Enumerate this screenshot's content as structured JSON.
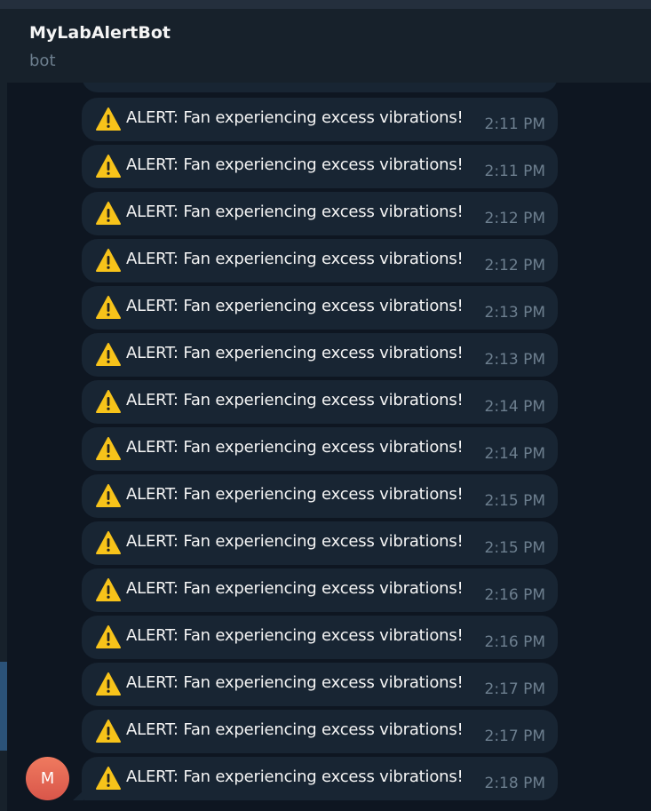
{
  "header": {
    "title": "MyLabAlertBot",
    "subtitle": "bot"
  },
  "avatar": {
    "initial": "M",
    "color": "#e2664f"
  },
  "colors": {
    "chat_bg": "#0e1621",
    "bubble": "#182533",
    "header": "#17212b",
    "time": "#6d7f8f",
    "selected": "#2b5278"
  },
  "messages": [
    {
      "icon": "warning-icon",
      "text": "ALERT: Fan experiencing excess vibrations!",
      "time": "2:11 PM"
    },
    {
      "icon": "warning-icon",
      "text": "ALERT: Fan experiencing excess vibrations!",
      "time": "2:11 PM"
    },
    {
      "icon": "warning-icon",
      "text": "ALERT: Fan experiencing excess vibrations!",
      "time": "2:12 PM"
    },
    {
      "icon": "warning-icon",
      "text": "ALERT: Fan experiencing excess vibrations!",
      "time": "2:12 PM"
    },
    {
      "icon": "warning-icon",
      "text": "ALERT: Fan experiencing excess vibrations!",
      "time": "2:13 PM"
    },
    {
      "icon": "warning-icon",
      "text": "ALERT: Fan experiencing excess vibrations!",
      "time": "2:13 PM"
    },
    {
      "icon": "warning-icon",
      "text": "ALERT: Fan experiencing excess vibrations!",
      "time": "2:14 PM"
    },
    {
      "icon": "warning-icon",
      "text": "ALERT: Fan experiencing excess vibrations!",
      "time": "2:14 PM"
    },
    {
      "icon": "warning-icon",
      "text": "ALERT: Fan experiencing excess vibrations!",
      "time": "2:15 PM"
    },
    {
      "icon": "warning-icon",
      "text": "ALERT: Fan experiencing excess vibrations!",
      "time": "2:15 PM"
    },
    {
      "icon": "warning-icon",
      "text": "ALERT: Fan experiencing excess vibrations!",
      "time": "2:16 PM"
    },
    {
      "icon": "warning-icon",
      "text": "ALERT: Fan experiencing excess vibrations!",
      "time": "2:16 PM"
    },
    {
      "icon": "warning-icon",
      "text": "ALERT: Fan experiencing excess vibrations!",
      "time": "2:17 PM"
    },
    {
      "icon": "warning-icon",
      "text": "ALERT: Fan experiencing excess vibrations!",
      "time": "2:17 PM"
    },
    {
      "icon": "warning-icon",
      "text": "ALERT: Fan experiencing excess vibrations!",
      "time": "2:18 PM"
    }
  ]
}
